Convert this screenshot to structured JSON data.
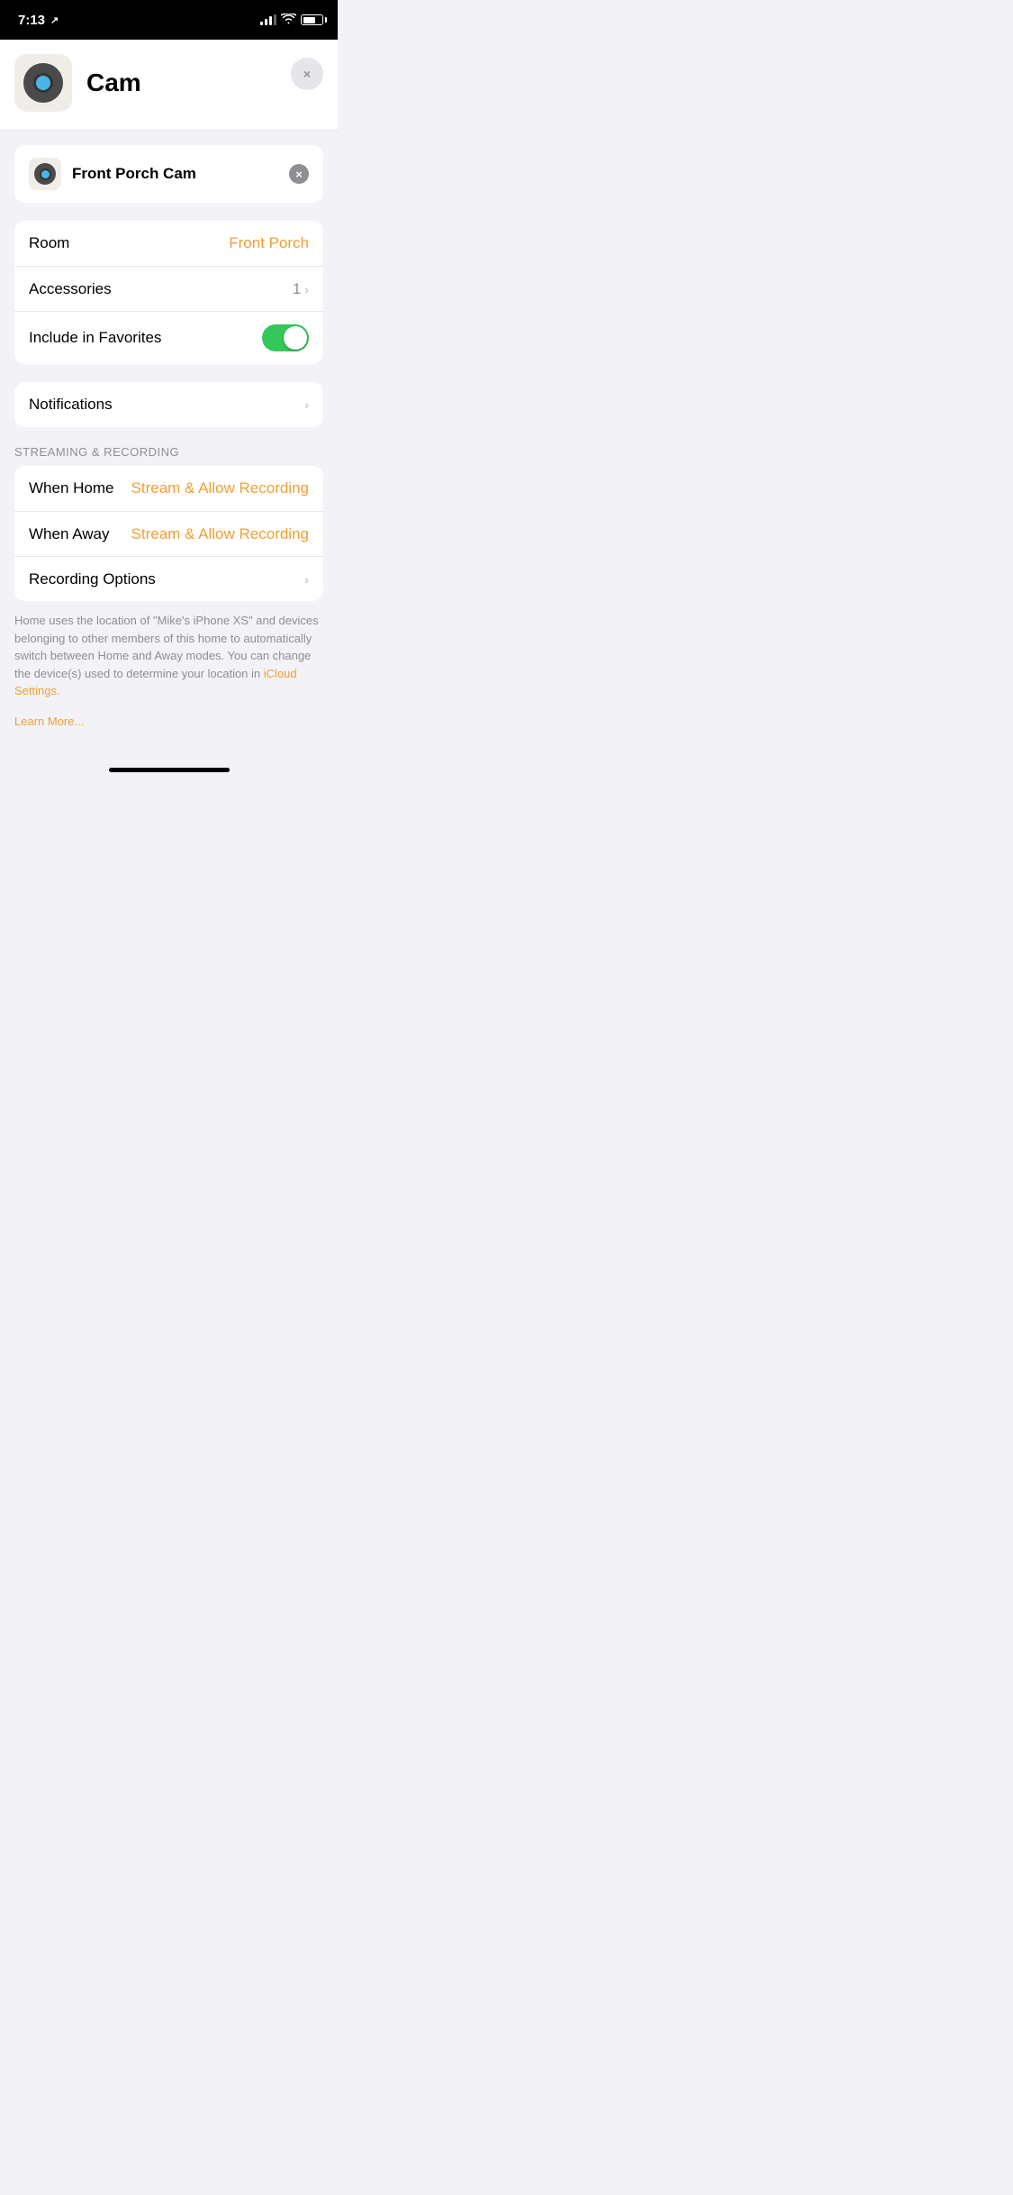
{
  "statusBar": {
    "time": "7:13",
    "locationIcon": "↗"
  },
  "header": {
    "title": "Cam",
    "closeLabel": "×"
  },
  "camNameSection": {
    "cameraName": "Front Porch Cam"
  },
  "settingsSection": {
    "roomLabel": "Room",
    "roomValue": "Front Porch",
    "accessoriesLabel": "Accessories",
    "accessoriesValue": "1",
    "favoritesLabel": "Include in Favorites"
  },
  "notificationsSection": {
    "label": "Notifications"
  },
  "streamingSection": {
    "sectionHeader": "STREAMING & RECORDING",
    "whenHomeLabel": "When Home",
    "whenHomeValue": "Stream & Allow Recording",
    "whenAwayLabel": "When Away",
    "whenAwayValue": "Stream & Allow Recording",
    "recordingOptionsLabel": "Recording Options"
  },
  "footerText": "Home uses the location of \"Mike's iPhone XS\" and devices belonging to other members of this home to automatically switch between Home and Away modes. You can change the device(s) used to determine your location in ",
  "iCloudSettingsLink": "iCloud Settings.",
  "learnMoreLink": "Learn More..."
}
